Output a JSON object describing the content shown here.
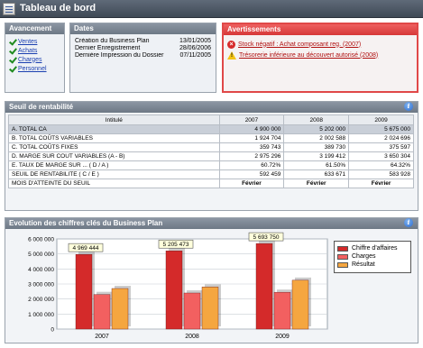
{
  "window": {
    "title": "Tableau de bord"
  },
  "avancement": {
    "title": "Avancement",
    "items": [
      {
        "label": "Ventes"
      },
      {
        "label": "Achats"
      },
      {
        "label": "Charges"
      },
      {
        "label": "Personnel"
      }
    ]
  },
  "dates": {
    "title": "Dates",
    "rows": [
      {
        "label": "Création du Business Plan",
        "value": "13/01/2005"
      },
      {
        "label": "Dernier Enregistrement",
        "value": "28/06/2006"
      },
      {
        "label": "Dernière Impression du Dossier",
        "value": "07/11/2005"
      }
    ]
  },
  "avertissements": {
    "title": "Avertissements",
    "items": [
      {
        "type": "error",
        "label": "Stock négatif : Achat composant reg. (2007)"
      },
      {
        "type": "warning",
        "label": "Trésorerie inférieure au découvert autorisé (2008)"
      }
    ]
  },
  "seuil": {
    "title": "Seuil de rentabilité",
    "headers": [
      "Intitulé",
      "2007",
      "2008",
      "2009"
    ],
    "rows": [
      {
        "label": "A.  TOTAL  CA",
        "values": [
          "4 900 000",
          "5 202 000",
          "5 675 000"
        ],
        "highlight": true
      },
      {
        "label": "B.  TOTAL  COÛTS  VARIABLES",
        "values": [
          "1 924 704",
          "2 002 588",
          "2 024 696"
        ]
      },
      {
        "label": "C.  TOTAL  COÛTS  FIXES",
        "values": [
          "359 743",
          "389 730",
          "375 597"
        ]
      },
      {
        "label": "D.  MARGE SUR COUT VARIABLES (A - B)",
        "values": [
          "2 975 296",
          "3 199 412",
          "3 650 304"
        ]
      },
      {
        "label": "E.  TAUX DE MARGE SUR ...  ( D / A )",
        "values": [
          "60.72%",
          "61.50%",
          "64.32%"
        ]
      },
      {
        "label": "SEUIL  DE  RENTABILITE  ( C / E )",
        "values": [
          "592 459",
          "633 671",
          "583 928"
        ]
      },
      {
        "label": "MOIS  D'ATTEINTE  DU  SEUIL",
        "values": [
          "Février",
          "Février",
          "Février"
        ],
        "bold": true
      }
    ]
  },
  "chart": {
    "title": "Evolution des chiffres clés du Business Plan"
  },
  "colors": {
    "ca": "#d42a2a",
    "charges": "#f26060",
    "resultat": "#f5a640"
  },
  "chart_data": {
    "type": "bar",
    "categories": [
      "2007",
      "2008",
      "2009"
    ],
    "series": [
      {
        "name": "Chiffre d'affaires",
        "values": [
          4969444,
          5205473,
          5693750
        ]
      },
      {
        "name": "Charges",
        "values": [
          2300000,
          2400000,
          2450000
        ]
      },
      {
        "name": "Résultat",
        "values": [
          2700000,
          2800000,
          3250000
        ]
      }
    ],
    "data_labels": [
      "4 969 444",
      "5 205 473",
      "5 693 750"
    ],
    "yticks": [
      "0",
      "1 000 000",
      "2 000 000",
      "3 000 000",
      "4 000 000",
      "5 000 000",
      "6 000 000"
    ],
    "ylim": [
      0,
      6000000
    ],
    "legend": "right",
    "grid": true
  }
}
